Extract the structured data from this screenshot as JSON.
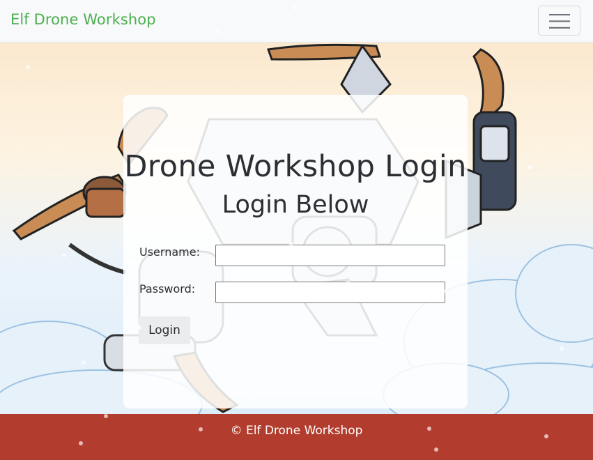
{
  "navbar": {
    "brand": "Elf Drone Workshop",
    "toggle_icon": "hamburger-menu-icon"
  },
  "login": {
    "title": "Drone Workshop Login",
    "subtitle": "Login Below",
    "username_label": "Username:",
    "username_value": "",
    "password_label": "Password:",
    "password_value": "",
    "submit_label": "Login"
  },
  "footer": {
    "text": "© Elf Drone Workshop"
  },
  "colors": {
    "brand": "#4caf50",
    "footer_bg": "#b23d2e",
    "navbar_bg": "#f8f9fa"
  }
}
